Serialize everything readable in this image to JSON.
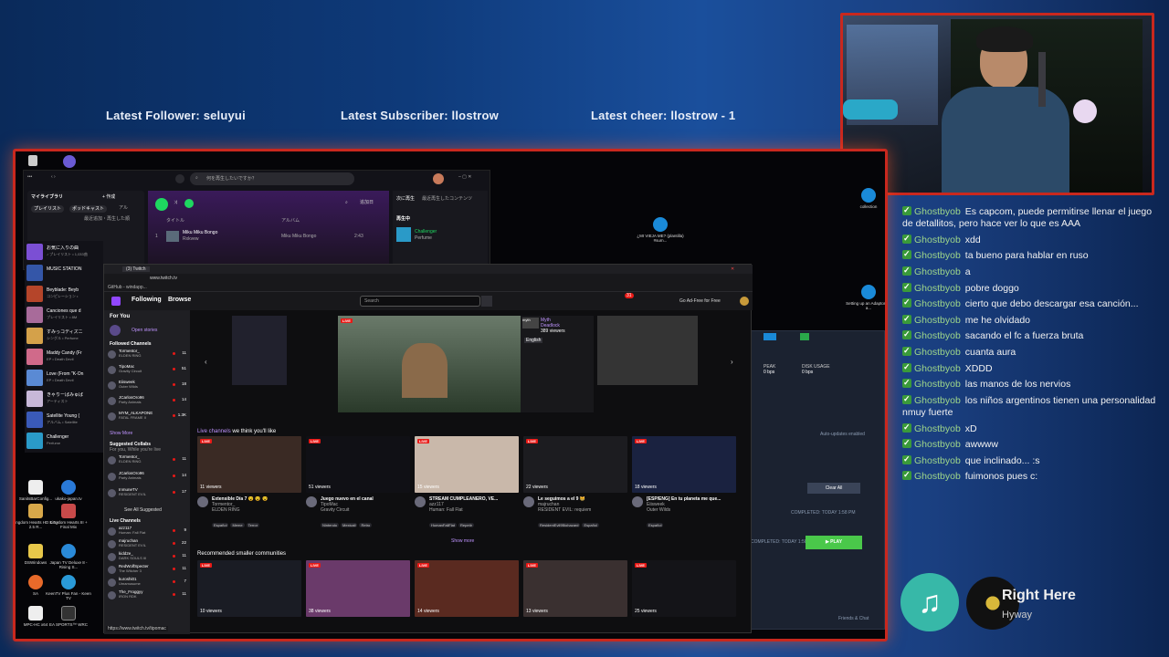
{
  "overlay": {
    "latest_follower": "Latest Follower: seluyui",
    "latest_subscriber": "Latest Subscriber: llostrow",
    "latest_cheer": "Latest cheer: llostrow - 1"
  },
  "desktop_icons": [
    {
      "label": "SanitsBarConfig..."
    },
    {
      "label": "ukako-japan.tv"
    },
    {
      "label": "Kingdom Hearts HD 1.5 + 2.5 R..."
    },
    {
      "label": "Kingdom Hearts III + Final Mix"
    },
    {
      "label": "DSWindows"
    },
    {
      "label": "Japan TV Deluxe 8 - Rising S..."
    },
    {
      "label": "SA"
    },
    {
      "label": "KeenTV Plus Fan - Keen TV"
    },
    {
      "label": "MPC-HC x64"
    },
    {
      "label": "EA SPORTS™ WRC"
    },
    {
      "label": "collection"
    },
    {
      "label": "Setting up an Adaptor for a..."
    },
    {
      "label": "¿MI VIEJA ME? (plantilla) #sum..."
    }
  ],
  "music_app": {
    "search_placeholder": "何を再生したいですか？",
    "library_title": "マイライブラリ",
    "create": "+ 作成",
    "filters": [
      "プレイリスト",
      "ポッドキャスト",
      "アル"
    ],
    "sort": "最近追加・再生した順",
    "items": [
      {
        "title": "お気に入りの曲",
        "sub": "♪ プレイリスト • 1,033曲",
        "color": "#7b4fd4"
      },
      {
        "title": "MUSIC STATION",
        "sub": "",
        "color": "#3456a8"
      },
      {
        "title": "Beyblade: Beyb",
        "sub": "コンピレーション •",
        "color": "#b5452a"
      },
      {
        "title": "Canciones que d",
        "sub": "プレイリスト • 8M",
        "color": "#a86b9a"
      },
      {
        "title": "すみっコディズニ",
        "sub": "シングル • Perfume",
        "color": "#d4a14a"
      },
      {
        "title": "Maddy Candy (Fr",
        "sub": "EP • Death Devil",
        "color": "#d06a8a"
      },
      {
        "title": "Love (From \"K-On",
        "sub": "EP • Death Devil",
        "color": "#5a8ad4"
      },
      {
        "title": "きゃりーぱみゅぱ",
        "sub": "アーティスト",
        "color": "#c8b8d8"
      },
      {
        "title": "Satellite Young (",
        "sub": "アルバム • Satellite",
        "color": "#3a5ab8"
      },
      {
        "title": "Challenger",
        "sub": "Perfume",
        "color": "#2a9ac8"
      }
    ],
    "table_headers": {
      "title": "タイトル",
      "album": "アルバム"
    },
    "track": {
      "num": "1",
      "title": "Miku Miku Bongo",
      "artist": "Rxkvew",
      "album": "Miku Miku Bongo",
      "time": "2:43"
    },
    "queue_tabs": [
      "次に再生",
      "最近再生したコンテンツ"
    ],
    "now_playing_label": "再生中",
    "queue_track": {
      "title": "Challenger",
      "artist": "Perfume"
    },
    "order": "追加日"
  },
  "twitch": {
    "tab": "(3) Twitch",
    "url": "www.twitch.tv",
    "github_tab": "GitHub - windapp...",
    "nav": {
      "following": "Following",
      "browse": "Browse",
      "search_placeholder": "Search",
      "ad_free": "Go Ad-Free for Free",
      "notif": "31"
    },
    "sidebar": {
      "for_you": "For You",
      "open_stories": "Open stories",
      "followed": "Followed Channels",
      "channels": [
        {
          "name": "Tormentor_",
          "game": "ELDEN RING",
          "v": "11"
        },
        {
          "name": "TipoMac",
          "game": "Gravity Circuit",
          "v": "51"
        },
        {
          "name": "Eiisweek",
          "game": "Outer Wilds",
          "v": "18"
        },
        {
          "name": "JCarlosOro96",
          "game": "Party Animals",
          "v": "14"
        },
        {
          "name": "MYM_ALKAPONE",
          "game": "FATAL FRAME II",
          "v": "1.3K"
        }
      ],
      "show_more": "Show More",
      "suggested": "Suggested Collabs",
      "suggested_sub": "For you, While you're live",
      "collabs": [
        {
          "name": "Tormentor_",
          "game": "ELDEN RING",
          "v": "11"
        },
        {
          "name": "JCarlosOro96",
          "game": "Party Animals",
          "v": "14"
        },
        {
          "name": "InmuneTV",
          "game": "RESIDENT EVIL",
          "v": "17"
        }
      ],
      "see_all": "See All Suggested",
      "live_title": "Live Channels",
      "live": [
        {
          "name": "azz117",
          "game": "Human: Fall Flat",
          "v": "9"
        },
        {
          "name": "majruchan",
          "game": "RESIDENT EVIL",
          "v": "22"
        },
        {
          "name": "kidd2e_",
          "game": "DARK SOULS III",
          "v": "11"
        },
        {
          "name": "RedWolfSpecter",
          "game": "The Witcher 3",
          "v": "11"
        },
        {
          "name": "kuroshi01",
          "game": "Umamusume",
          "v": "7"
        },
        {
          "name": "The_Froggyy",
          "game": "IRON RDK",
          "v": "11"
        }
      ]
    },
    "featured": {
      "channel": "Myth",
      "game": "Deadlock",
      "viewers": "389 viewers",
      "lang": "English",
      "live": "LIVE"
    },
    "live_channels_title": "Live channels",
    "live_channels_suffix": "we think you'll like",
    "cards": [
      {
        "viewers": "11 viewers",
        "title": "Extensible Día 7 😵 😵 😵",
        "ch": "Tormentor_",
        "game": "ELDEN RING",
        "tags": [
          "Español",
          "Meme",
          "Terror"
        ],
        "color": "#3a2a24"
      },
      {
        "viewers": "51 viewers",
        "title": "Juego nuevo en el canal",
        "ch": "TipoMac",
        "game": "Gravity Circuit",
        "tags": [
          "Nintendo",
          "Mexicali",
          "Retro"
        ],
        "color": "#101015"
      },
      {
        "viewers": "15 viewers",
        "title": "STREAM CUMPLEAÑERO, VE...",
        "ch": "azz117",
        "game": "Human: Fall Flat",
        "tags": [
          "HumanFallFlat",
          "Repetir"
        ],
        "color": "#c9b8aa"
      },
      {
        "viewers": "22 viewers",
        "title": "Le seguimos a el 9 😸",
        "ch": "majruchan",
        "game": "RESIDENT EVIL: requiem",
        "tags": [
          "ResidentEvil9Biohazard",
          "Español"
        ],
        "color": "#1c1c20"
      },
      {
        "viewers": "18 viewers",
        "title": "[ESP/ENG] En tu planeta me que...",
        "ch": "Eiisweek",
        "game": "Outer Wilds",
        "tags": [
          "Español"
        ],
        "color": "#1a2240"
      }
    ],
    "show_more": "Show more",
    "rec_title": "Recommended smaller communities",
    "rec": [
      {
        "viewers": "10 viewers",
        "color": "#1a1c24"
      },
      {
        "viewers": "38 viewers",
        "color": "#6a3a6a"
      },
      {
        "viewers": "14 viewers",
        "color": "#5a2a20"
      },
      {
        "viewers": "13 viewers",
        "color": "#3a3030"
      },
      {
        "viewers": "25 viewers",
        "color": "#141418"
      }
    ],
    "status_url": "https://www.twitch.tv/tipomac"
  },
  "download_panel": {
    "peak": "PEAK",
    "peak_val": "0 bps",
    "disk": "DISK USAGE",
    "disk_val": "0 bps",
    "auto": "Auto-updates enabled",
    "clear": "Clear All",
    "completed": "COMPLETED: TODAY 1:58 PM",
    "completed2": "COMPLETED: TODAY 1:58 PM",
    "play": "▶ PLAY",
    "friends": "Friends & Chat"
  },
  "chat": [
    {
      "user": "Ghostbyob",
      "text": "Es capcom, puede permitirse llenar el juego de detallitos, pero hace ver lo que es AAA"
    },
    {
      "user": "Ghostbyob",
      "text": "xdd"
    },
    {
      "user": "Ghostbyob",
      "text": "ta bueno para hablar en ruso"
    },
    {
      "user": "Ghostbyob",
      "text": "a"
    },
    {
      "user": "Ghostbyob",
      "text": "pobre doggo"
    },
    {
      "user": "Ghostbyob",
      "text": "cierto que debo descargar esa canción..."
    },
    {
      "user": "Ghostbyob",
      "text": "me he olvidado"
    },
    {
      "user": "Ghostbyob",
      "text": "sacando el fc a fuerza bruta"
    },
    {
      "user": "Ghostbyob",
      "text": "cuanta aura"
    },
    {
      "user": "Ghostbyob",
      "text": "XDDD"
    },
    {
      "user": "Ghostbyob",
      "text": "las manos de los nervios"
    },
    {
      "user": "Ghostbyob",
      "text": "los niños argentinos tienen una personalidad nmuy fuerte"
    },
    {
      "user": "Ghostbyob",
      "text": "xD"
    },
    {
      "user": "Ghostbyob",
      "text": "awwww"
    },
    {
      "user": "Ghostbyob",
      "text": "que inclinado... :s"
    },
    {
      "user": "Ghostbyob",
      "text": "fuimonos pues c:"
    }
  ],
  "now_playing": {
    "title": "Right Here",
    "artist": "Hyway"
  },
  "colors": {
    "frame": "#c9281e",
    "twitch_purple": "#9147ff",
    "spotify_green": "#1ed760",
    "chat_user": "#9ed68a",
    "live_red": "#e91916"
  }
}
